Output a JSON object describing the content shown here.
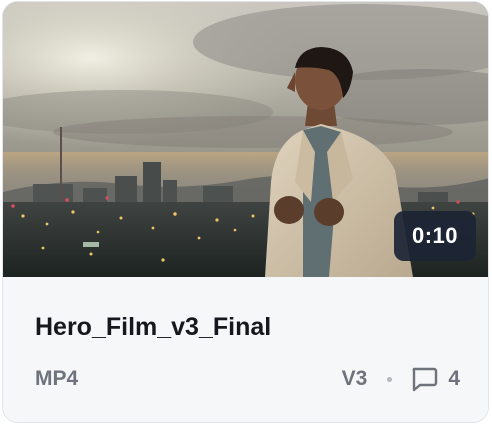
{
  "card": {
    "duration": "0:10",
    "title": "Hero_Film_v3_Final",
    "format": "MP4",
    "version": "V3",
    "comment_count": "4",
    "icons": {
      "comments": "speech-bubble-icon"
    },
    "colors": {
      "badge_bg": "#1c2434",
      "title_text": "#16181d",
      "meta_text": "#6e737c",
      "card_bg": "#f6f7f9"
    }
  }
}
